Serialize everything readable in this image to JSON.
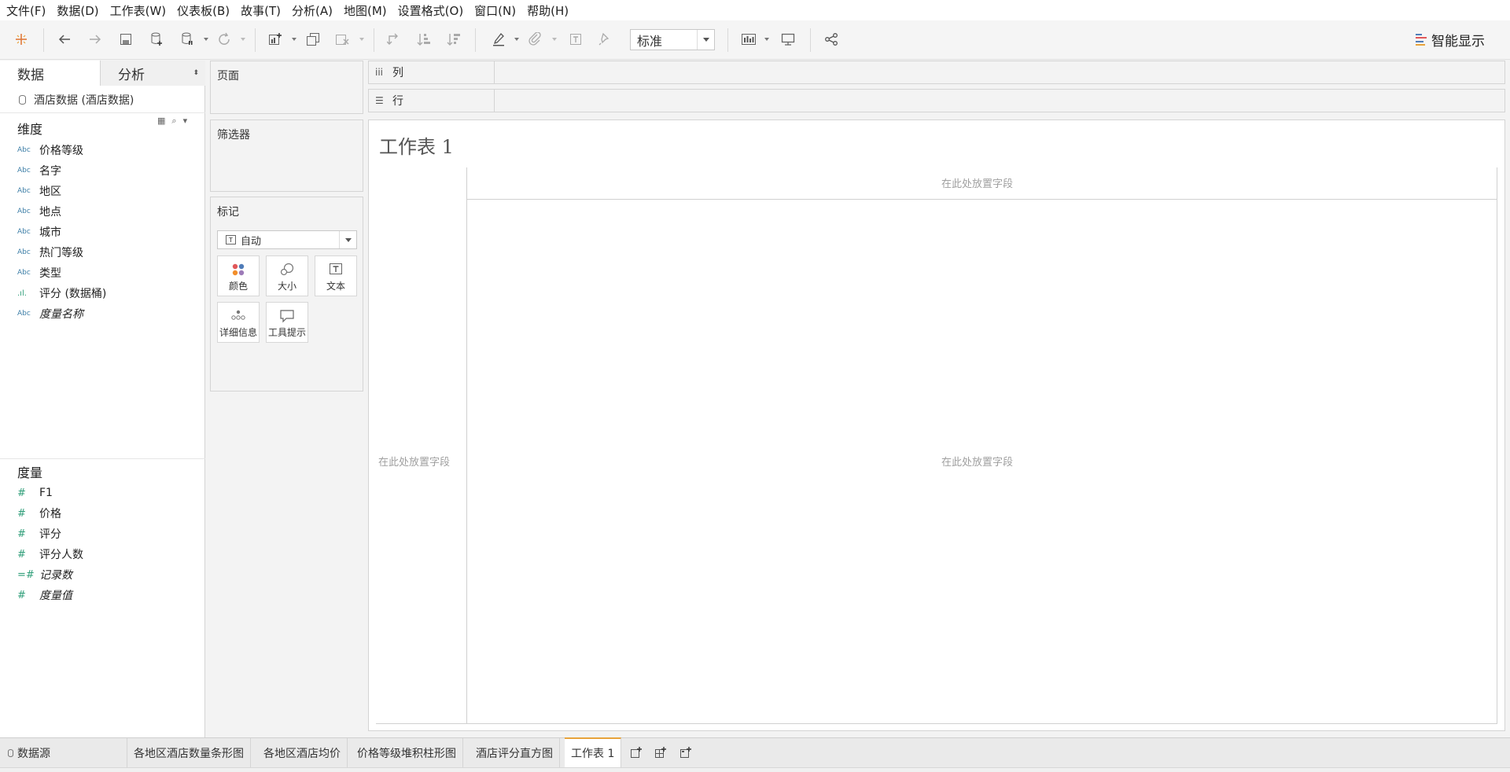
{
  "menu": [
    "文件(F)",
    "数据(D)",
    "工作表(W)",
    "仪表板(B)",
    "故事(T)",
    "分析(A)",
    "地图(M)",
    "设置格式(O)",
    "窗口(N)",
    "帮助(H)"
  ],
  "toolbar": {
    "fit_select_value": "标准",
    "smart_show_label": "智能显示"
  },
  "data_pane": {
    "tab_data": "数据",
    "tab_analysis": "分析",
    "datasource": "酒店数据 (酒店数据)",
    "dimensions_title": "维度",
    "dimensions": [
      {
        "name": "价格等级",
        "type": "Abc"
      },
      {
        "name": "名字",
        "type": "Abc"
      },
      {
        "name": "地区",
        "type": "Abc"
      },
      {
        "name": "地点",
        "type": "Abc"
      },
      {
        "name": "城市",
        "type": "Abc"
      },
      {
        "name": "热门等级",
        "type": "Abc"
      },
      {
        "name": "类型",
        "type": "Abc"
      },
      {
        "name": "评分 (数据桶)",
        "type": ".ıl."
      },
      {
        "name": "度量名称",
        "type": "Abc"
      }
    ],
    "measures_title": "度量",
    "measures": [
      {
        "name": "F1",
        "type": "#"
      },
      {
        "name": "价格",
        "type": "#"
      },
      {
        "name": "评分",
        "type": "#"
      },
      {
        "name": "评分人数",
        "type": "#"
      },
      {
        "name": "记录数",
        "type": "=#"
      },
      {
        "name": "度量值",
        "type": "#"
      }
    ]
  },
  "cards": {
    "pages": "页面",
    "filters": "筛选器",
    "marks": "标记",
    "mark_type": "自动",
    "mark_buttons": [
      "颜色",
      "大小",
      "文本",
      "详细信息",
      "工具提示"
    ]
  },
  "shelves": {
    "columns": "列",
    "rows": "行"
  },
  "viz": {
    "title": "工作表 1",
    "drop_top": "在此处放置字段",
    "drop_left": "在此处放置字段",
    "drop_center": "在此处放置字段"
  },
  "bottom_tabs": {
    "datasource": "数据源",
    "sheets": [
      "各地区酒店数量条形图",
      "各地区酒店均价",
      "价格等级堆积柱形图",
      "酒店评分直方图",
      "工作表 1"
    ]
  },
  "colors": {
    "accent_tab": "#e8a33b",
    "dimension_icon": "#3e7fa7",
    "measure_icon": "#2f9e79"
  }
}
